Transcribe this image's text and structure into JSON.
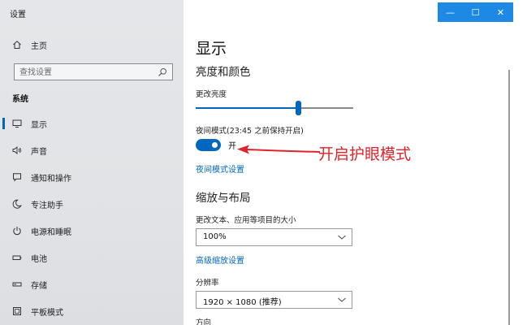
{
  "window": {
    "title": "设置",
    "controls": {
      "minimize": "—",
      "maximize": "☐",
      "close": "✕"
    }
  },
  "sidebar": {
    "home_label": "主页",
    "search_placeholder": "查找设置",
    "section_title": "系统",
    "items": [
      {
        "icon": "monitor-icon",
        "label": "显示",
        "selected": true
      },
      {
        "icon": "speaker-icon",
        "label": "声音",
        "selected": false
      },
      {
        "icon": "message-icon",
        "label": "通知和操作",
        "selected": false
      },
      {
        "icon": "moon-icon",
        "label": "专注助手",
        "selected": false
      },
      {
        "icon": "power-icon",
        "label": "电源和睡眠",
        "selected": false
      },
      {
        "icon": "battery-icon",
        "label": "电池",
        "selected": false
      },
      {
        "icon": "storage-icon",
        "label": "存储",
        "selected": false
      },
      {
        "icon": "tablet-icon",
        "label": "平板模式",
        "selected": false
      }
    ]
  },
  "main": {
    "title": "显示",
    "brightness_section": "亮度和颜色",
    "brightness_label": "更改亮度",
    "brightness_level": 0.65,
    "night_light_label": "夜间模式(23:45 之前保持开启)",
    "night_light_state": "开",
    "night_light_on": true,
    "night_light_link": "夜间模式设置",
    "annotation": "开启护眼模式",
    "scale_section": "缩放与布局",
    "text_size_label": "更改文本、应用等项目的大小",
    "scale_value": "100%",
    "advanced_scaling_link": "高级缩放设置",
    "resolution_label": "分辨率",
    "resolution_value": "1920 × 1080 (推荐)",
    "orientation_label": "方向"
  },
  "colors": {
    "accent": "#0067c0",
    "annotation": "#e0242b",
    "title_bar_buttons": "#1e88e5"
  }
}
